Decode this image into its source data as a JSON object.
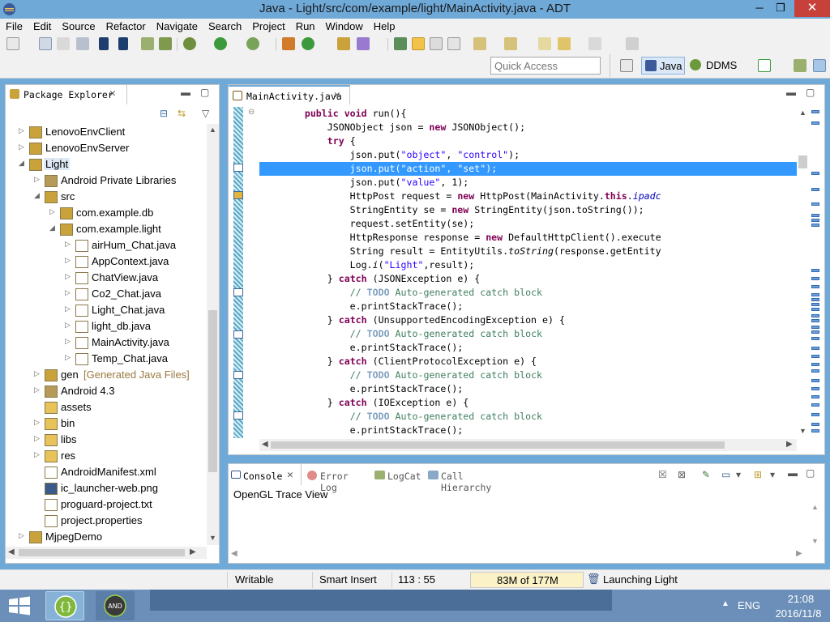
{
  "window": {
    "title": "Java - Light/src/com/example/light/MainActivity.java - ADT",
    "minimize_icon": "minimize-icon",
    "maximize_icon": "restore-icon",
    "close_icon": "close-icon",
    "minimize_glyph": "─",
    "restore_glyph": "❐",
    "close_glyph": "✕"
  },
  "menu": [
    "File",
    "Edit",
    "Source",
    "Refactor",
    "Navigate",
    "Search",
    "Project",
    "Run",
    "Window",
    "Help"
  ],
  "toolbar": {
    "quick_access_placeholder": "Quick Access",
    "perspectives": {
      "java": "Java",
      "ddms": "DDMS"
    }
  },
  "package_explorer": {
    "tab_label": "Package Explorer",
    "tree": [
      {
        "label": "LenovoEnvClient",
        "icon": "project-icon",
        "arrow": "collapsed"
      },
      {
        "label": "LenovoEnvServer",
        "icon": "project-icon",
        "arrow": "collapsed"
      },
      {
        "label": "Light",
        "icon": "project-icon",
        "arrow": "expanded",
        "selected": true
      },
      {
        "label": "Android Private Libraries",
        "icon": "library-icon",
        "arrow": "collapsed"
      },
      {
        "label": "src",
        "icon": "source-folder-icon",
        "arrow": "expanded"
      },
      {
        "label": "com.example.db",
        "icon": "package-icon",
        "arrow": "collapsed"
      },
      {
        "label": "com.example.light",
        "icon": "package-icon",
        "arrow": "expanded"
      },
      {
        "label": "airHum_Chat.java",
        "icon": "java-file-icon",
        "arrow": "collapsed"
      },
      {
        "label": "AppContext.java",
        "icon": "java-file-icon",
        "arrow": "collapsed"
      },
      {
        "label": "ChatView.java",
        "icon": "java-file-icon",
        "arrow": "collapsed"
      },
      {
        "label": "Co2_Chat.java",
        "icon": "java-file-icon",
        "arrow": "collapsed"
      },
      {
        "label": "Light_Chat.java",
        "icon": "java-file-icon",
        "arrow": "collapsed"
      },
      {
        "label": "light_db.java",
        "icon": "java-file-icon",
        "arrow": "collapsed"
      },
      {
        "label": "MainActivity.java",
        "icon": "java-file-icon",
        "arrow": "collapsed"
      },
      {
        "label": "Temp_Chat.java",
        "icon": "java-file-icon",
        "arrow": "collapsed"
      },
      {
        "label": "gen",
        "decoration": "[Generated Java Files]",
        "icon": "source-folder-icon",
        "arrow": "collapsed"
      },
      {
        "label": "Android 4.3",
        "icon": "library-icon",
        "arrow": "collapsed"
      },
      {
        "label": "assets",
        "icon": "folder-icon",
        "arrow": "none"
      },
      {
        "label": "bin",
        "icon": "folder-icon",
        "arrow": "collapsed"
      },
      {
        "label": "libs",
        "icon": "folder-icon",
        "arrow": "collapsed"
      },
      {
        "label": "res",
        "icon": "folder-icon",
        "arrow": "collapsed"
      },
      {
        "label": "AndroidManifest.xml",
        "icon": "xml-file-icon",
        "arrow": "none"
      },
      {
        "label": "ic_launcher-web.png",
        "icon": "image-file-icon",
        "arrow": "none"
      },
      {
        "label": "proguard-project.txt",
        "icon": "text-file-icon",
        "arrow": "none"
      },
      {
        "label": "project.properties",
        "icon": "text-file-icon",
        "arrow": "none"
      },
      {
        "label": "MjpegDemo",
        "icon": "project-icon",
        "arrow": "collapsed"
      }
    ]
  },
  "editor": {
    "tab_label": "MainActivity.java",
    "highlighted_line": 4,
    "lines": [
      [
        [
          "",
          "        "
        ],
        [
          "kw",
          "public void"
        ],
        [
          "",
          " run(){"
        ]
      ],
      [
        [
          "",
          "            JSONObject json = "
        ],
        [
          "kw",
          "new"
        ],
        [
          "",
          " JSONObject();"
        ]
      ],
      [
        [
          "",
          "            "
        ],
        [
          "kw",
          "try"
        ],
        [
          "",
          " {"
        ]
      ],
      [
        [
          "",
          "                json.put("
        ],
        [
          "str",
          "\"object\""
        ],
        [
          "",
          ", "
        ],
        [
          "str",
          "\"control\""
        ],
        [
          "",
          ");"
        ]
      ],
      [
        [
          "",
          "                json.put("
        ],
        [
          "str",
          "\"action\""
        ],
        [
          "",
          ", "
        ],
        [
          "str",
          "\"set\""
        ],
        [
          "",
          ");"
        ]
      ],
      [
        [
          "",
          "                json.put("
        ],
        [
          "str",
          "\"value\""
        ],
        [
          "",
          ", 1);"
        ]
      ],
      [
        [
          "",
          "                HttpPost request = "
        ],
        [
          "kw",
          "new"
        ],
        [
          "",
          " HttpPost(MainActivity."
        ],
        [
          "kw",
          "this"
        ],
        [
          "",
          "."
        ],
        [
          "fld",
          "ipadc"
        ]
      ],
      [
        [
          "",
          "                StringEntity se = "
        ],
        [
          "kw",
          "new"
        ],
        [
          "",
          " StringEntity(json.toString());"
        ]
      ],
      [
        [
          "",
          "                request.setEntity(se);"
        ]
      ],
      [
        [
          "",
          "                HttpResponse response = "
        ],
        [
          "kw",
          "new"
        ],
        [
          "",
          " DefaultHttpClient().execute"
        ]
      ],
      [
        [
          "",
          "                String result = EntityUtils."
        ],
        [
          "ital",
          "toString"
        ],
        [
          "",
          "(response.getEntity"
        ]
      ],
      [
        [
          "",
          "                Log."
        ],
        [
          "ital",
          "i"
        ],
        [
          "",
          "("
        ],
        [
          "str",
          "\"Light\""
        ],
        [
          "",
          ",result);"
        ]
      ],
      [
        [
          "",
          "            } "
        ],
        [
          "kw",
          "catch"
        ],
        [
          "",
          " (JSONException e) {"
        ]
      ],
      [
        [
          "",
          "                "
        ],
        [
          "cmt",
          "// "
        ],
        [
          "todo",
          "TODO"
        ],
        [
          "cmt",
          " Auto-generated catch block"
        ]
      ],
      [
        [
          "",
          "                e.printStackTrace();"
        ]
      ],
      [
        [
          "",
          "            } "
        ],
        [
          "kw",
          "catch"
        ],
        [
          "",
          " (UnsupportedEncodingException e) {"
        ]
      ],
      [
        [
          "",
          "                "
        ],
        [
          "cmt",
          "// "
        ],
        [
          "todo",
          "TODO"
        ],
        [
          "cmt",
          " Auto-generated catch block"
        ]
      ],
      [
        [
          "",
          "                e.printStackTrace();"
        ]
      ],
      [
        [
          "",
          "            } "
        ],
        [
          "kw",
          "catch"
        ],
        [
          "",
          " (ClientProtocolException e) {"
        ]
      ],
      [
        [
          "",
          "                "
        ],
        [
          "cmt",
          "// "
        ],
        [
          "todo",
          "TODO"
        ],
        [
          "cmt",
          " Auto-generated catch block"
        ]
      ],
      [
        [
          "",
          "                e.printStackTrace();"
        ]
      ],
      [
        [
          "",
          "            } "
        ],
        [
          "kw",
          "catch"
        ],
        [
          "",
          " (IOException e) {"
        ]
      ],
      [
        [
          "",
          "                "
        ],
        [
          "cmt",
          "// "
        ],
        [
          "todo",
          "TODO"
        ],
        [
          "cmt",
          " Auto-generated catch block"
        ]
      ],
      [
        [
          "",
          "                e.printStackTrace();"
        ]
      ]
    ]
  },
  "bottom_views": {
    "tabs": [
      "Console",
      "Error Log",
      "LogCat",
      "Call Hierarchy"
    ],
    "console_text": "OpenGL Trace View"
  },
  "status": {
    "writable": "Writable",
    "insert_mode": "Smart Insert",
    "position": "113 : 55",
    "heap": "83M of 177M",
    "job": "Launching Light"
  },
  "taskbar": {
    "lang": "ENG",
    "time": "21:08",
    "date": "2016/11/8"
  },
  "colors": {
    "titlebar": "#6fa9d8",
    "selection": "#3399ff",
    "keyword": "#7f0055",
    "string": "#2a00ff",
    "comment": "#3f7f5f"
  }
}
